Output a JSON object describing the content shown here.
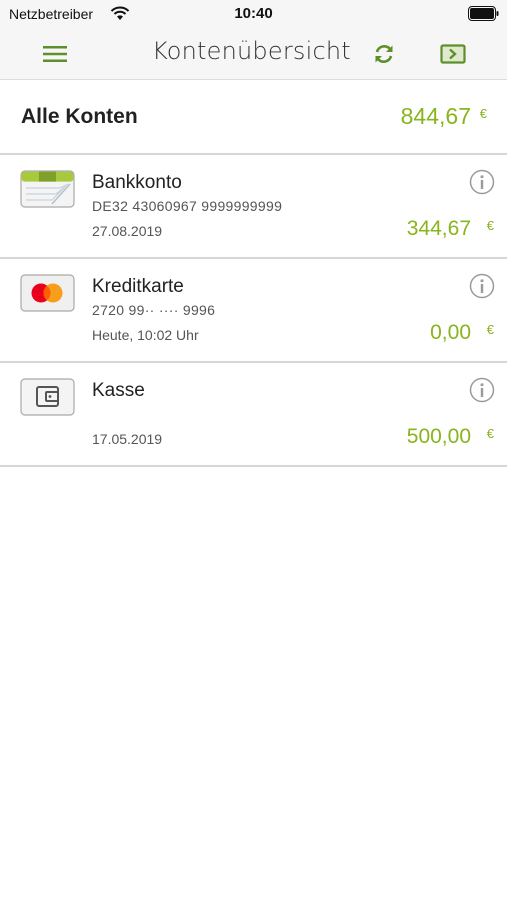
{
  "status_bar": {
    "carrier": "Netzbetreiber",
    "time": "10:40"
  },
  "nav": {
    "title": "Kontenübersicht",
    "menu_icon": "hamburger-menu-icon",
    "refresh_icon": "refresh-icon",
    "logout_icon": "logout-icon"
  },
  "summary": {
    "label": "Alle Konten",
    "amount": "844,67",
    "currency": "€"
  },
  "accounts": [
    {
      "name": "Bankkonto",
      "sub": "DE32 43060967 9999999999",
      "date": "27.08.2019",
      "amount": "344,67",
      "currency": "€",
      "icon": "bank-account-icon"
    },
    {
      "name": "Kreditkarte",
      "sub": "2720 99·· ···· 9996",
      "date": "Heute, 10:02 Uhr",
      "amount": "0,00",
      "currency": "€",
      "icon": "credit-card-icon"
    },
    {
      "name": "Kasse",
      "sub": "",
      "date": "17.05.2019",
      "amount": "500,00",
      "currency": "€",
      "icon": "wallet-icon"
    }
  ],
  "colors": {
    "accent": "#8ab41c",
    "nav_icon": "#5f8f2a",
    "divider": "#d6d6d6"
  }
}
